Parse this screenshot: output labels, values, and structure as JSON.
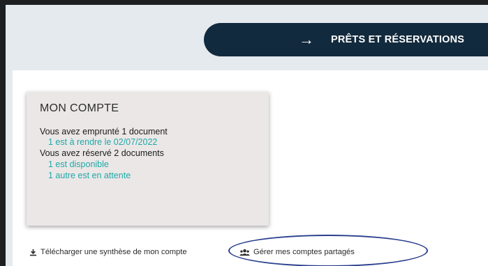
{
  "nav": {
    "arrow_icon": "arrow-right-icon",
    "label": "PRÊTS ET RÉSERVATIONS",
    "chevron_icon": "chevron-down-icon"
  },
  "account": {
    "title": "MON COMPTE",
    "borrowed": "Vous avez emprunté 1 document",
    "return_due": "1 est à rendre le 02/07/2022",
    "reserved": "Vous avez réservé 2 documents",
    "available": "1 est disponible",
    "waiting": "1 autre est en attente"
  },
  "footer": {
    "download_label": "Télécharger une synthèse de mon compte",
    "shared_label": "Gérer mes comptes partagés"
  },
  "colors": {
    "nav_bg": "#122a3d",
    "link": "#1fa9a8",
    "highlight": "#2a3f8d"
  }
}
